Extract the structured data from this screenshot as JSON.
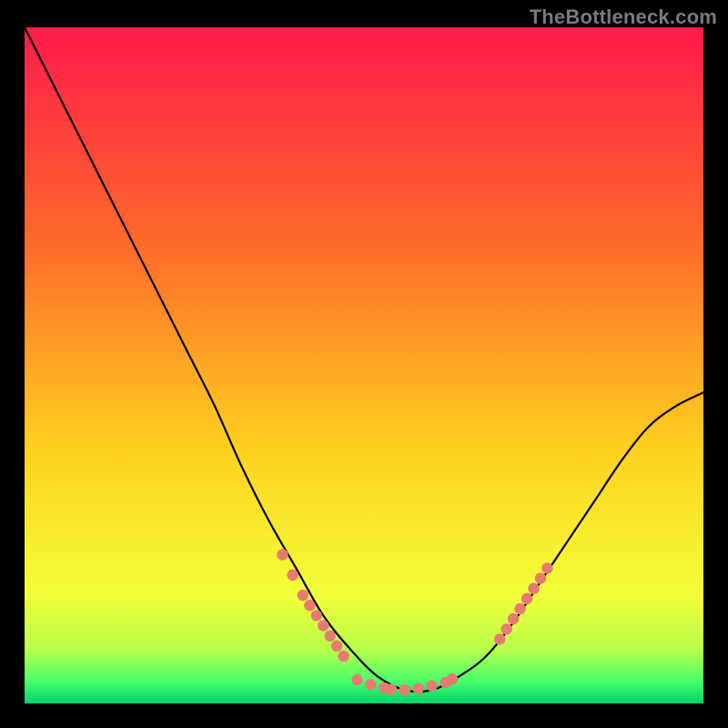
{
  "watermark": "TheBottleneck.com",
  "chart_data": {
    "type": "line",
    "title": "",
    "xlabel": "",
    "ylabel": "",
    "xlim": [
      0,
      100
    ],
    "ylim": [
      0,
      100
    ],
    "grid": false,
    "legend": false,
    "gradient_colors": {
      "top": "#ff1a4b",
      "mid_upper": "#ff7f27",
      "mid_lower": "#ffe600",
      "lower": "#5fff5f",
      "bottom": "#00d36b"
    },
    "series": [
      {
        "name": "curve",
        "color": "#000000",
        "x": [
          0,
          4,
          8,
          12,
          16,
          20,
          24,
          28,
          32,
          36,
          40,
          44,
          48,
          52,
          56,
          60,
          64,
          68,
          72,
          76,
          80,
          84,
          88,
          92,
          96,
          100
        ],
        "y": [
          100,
          92,
          84,
          76,
          68,
          60,
          52,
          44,
          35,
          27,
          20,
          13,
          8,
          4,
          2,
          2,
          4,
          7,
          12,
          18,
          24,
          30,
          36,
          41,
          44,
          46
        ]
      },
      {
        "name": "dots-left",
        "color": "#e77b72",
        "x": [
          38,
          39.5,
          41,
          42,
          43,
          44,
          45,
          46,
          47
        ],
        "y": [
          22,
          19,
          16,
          14.5,
          13,
          11.5,
          10,
          8.5,
          7
        ]
      },
      {
        "name": "dots-bottom",
        "color": "#e77b72",
        "x": [
          49,
          51,
          53,
          54,
          56,
          58,
          60,
          62,
          63
        ],
        "y": [
          3.5,
          2.8,
          2.3,
          2.1,
          2.0,
          2.2,
          2.6,
          3.1,
          3.6
        ]
      },
      {
        "name": "dots-right",
        "color": "#e77b72",
        "x": [
          70,
          71,
          72,
          73,
          74,
          75,
          76,
          77
        ],
        "y": [
          9.5,
          11,
          12.5,
          14,
          15.5,
          17,
          18.5,
          20
        ]
      }
    ]
  }
}
